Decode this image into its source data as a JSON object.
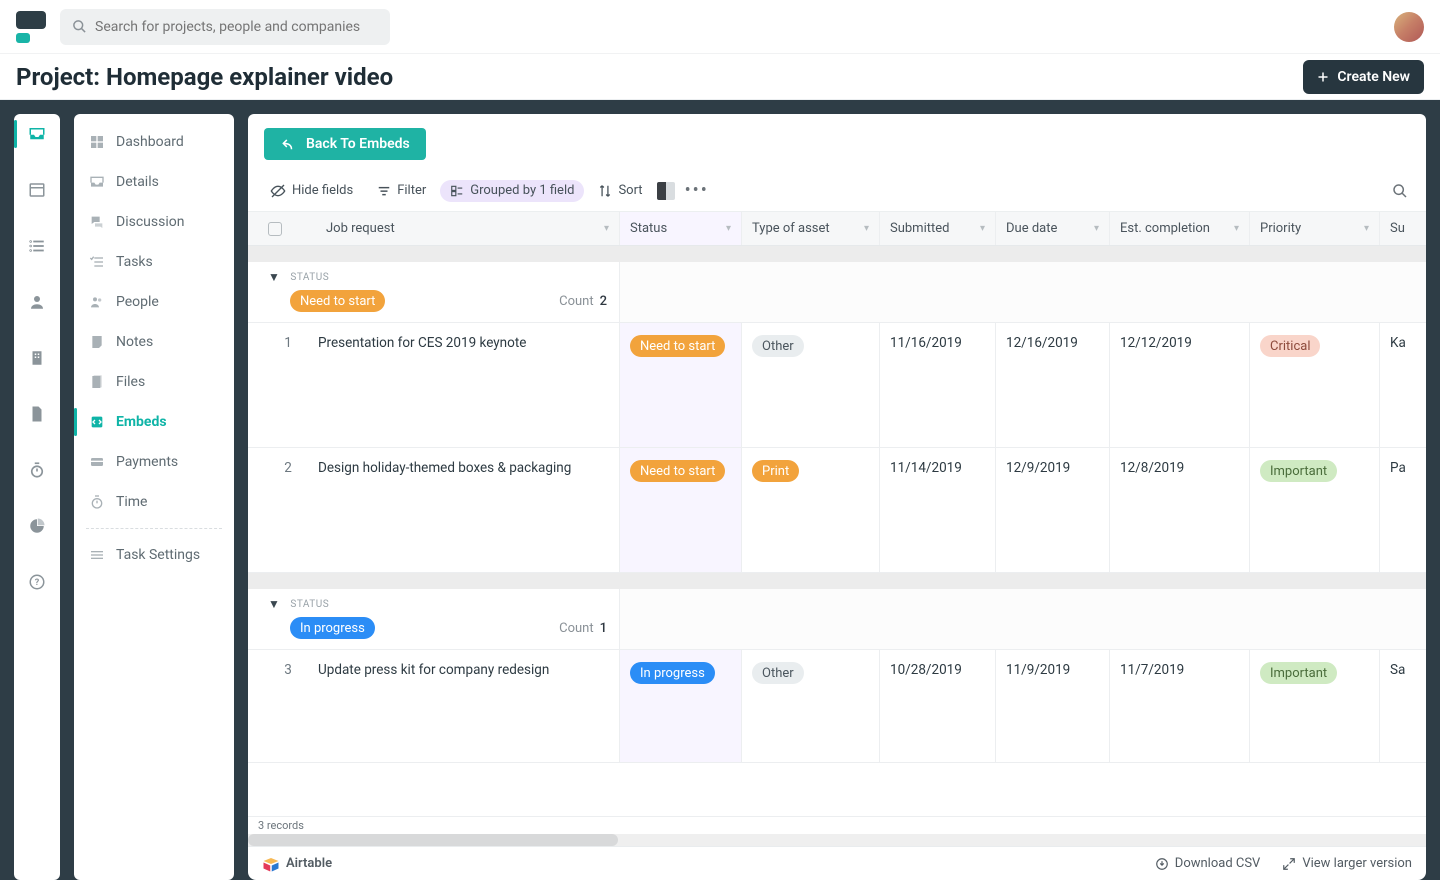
{
  "search": {
    "placeholder": "Search for projects, people and companies"
  },
  "header": {
    "page_title": "Project: Homepage explainer video",
    "create_label": "Create New"
  },
  "sidebar": {
    "items": [
      {
        "label": "Dashboard"
      },
      {
        "label": "Details"
      },
      {
        "label": "Discussion"
      },
      {
        "label": "Tasks"
      },
      {
        "label": "People"
      },
      {
        "label": "Notes"
      },
      {
        "label": "Files"
      },
      {
        "label": "Embeds"
      },
      {
        "label": "Payments"
      },
      {
        "label": "Time"
      }
    ],
    "settings_label": "Task Settings"
  },
  "embed": {
    "back_label": "Back To Embeds",
    "tools": {
      "hide": "Hide fields",
      "filter": "Filter",
      "group": "Grouped by 1 field",
      "sort": "Sort"
    },
    "columns": {
      "job": "Job request",
      "status": "Status",
      "asset": "Type of asset",
      "submitted": "Submitted",
      "due": "Due date",
      "est": "Est. completion",
      "prio": "Priority",
      "last": "Su"
    },
    "group_label": "STATUS",
    "count_label": "Count",
    "groups": [
      {
        "status": "Need to start",
        "pill": "pill-orange",
        "count": "2",
        "rows": [
          {
            "num": "1",
            "job": "Presentation for CES 2019 keynote",
            "status": "Need to start",
            "status_pill": "pill-orange",
            "asset": "Other",
            "asset_pill": "pill-grey",
            "submitted": "11/16/2019",
            "due": "12/16/2019",
            "est": "12/12/2019",
            "prio": "Critical",
            "prio_pill": "pill-red",
            "last": "Ka"
          },
          {
            "num": "2",
            "job": "Design holiday-themed boxes & packaging",
            "status": "Need to start",
            "status_pill": "pill-orange",
            "asset": "Print",
            "asset_pill": "pill-orange",
            "submitted": "11/14/2019",
            "due": "12/9/2019",
            "est": "12/8/2019",
            "prio": "Important",
            "prio_pill": "pill-green",
            "last": "Pa"
          }
        ]
      },
      {
        "status": "In progress",
        "pill": "pill-blue",
        "count": "1",
        "rows": [
          {
            "num": "3",
            "job": "Update press kit for company redesign",
            "status": "In progress",
            "status_pill": "pill-blue",
            "asset": "Other",
            "asset_pill": "pill-grey",
            "submitted": "10/28/2019",
            "due": "11/9/2019",
            "est": "11/7/2019",
            "prio": "Important",
            "prio_pill": "pill-green",
            "last": "Sa"
          }
        ]
      }
    ],
    "records_label": "3 records",
    "footer": {
      "brand": "Airtable",
      "download": "Download CSV",
      "larger": "View larger version"
    }
  }
}
